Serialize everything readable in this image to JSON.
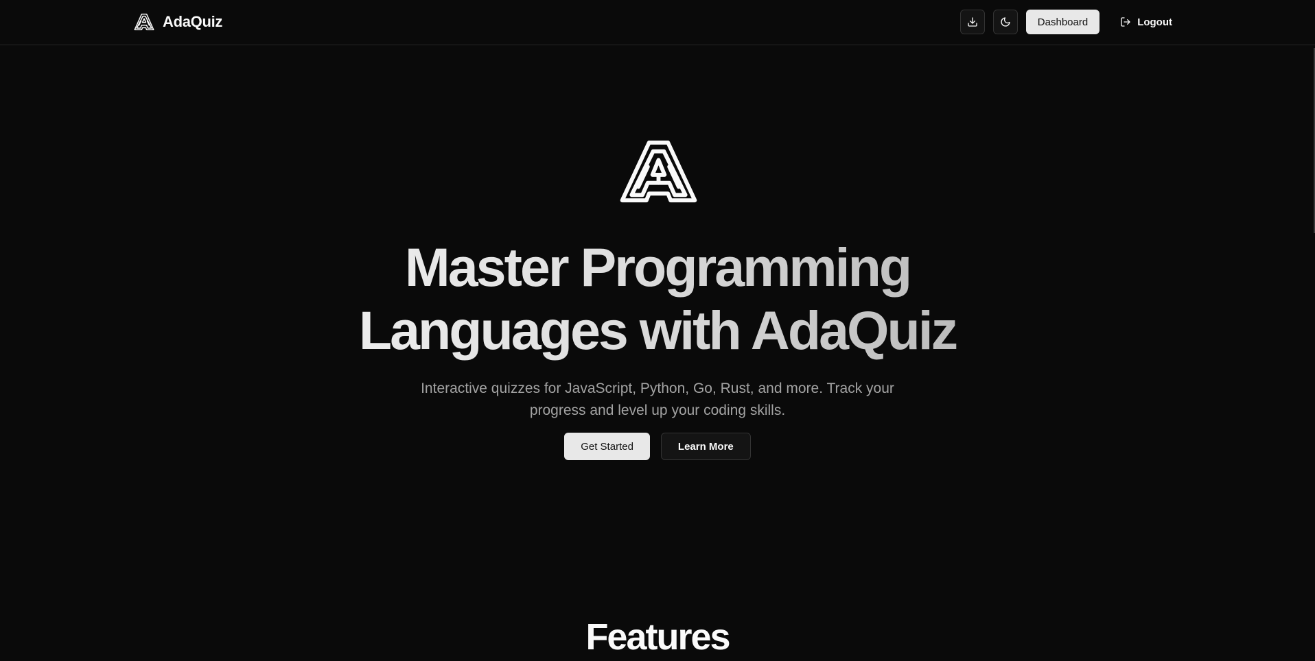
{
  "app": {
    "name": "AdaQuiz",
    "logo_icon": "adaquiz-logo-icon"
  },
  "header": {
    "download_icon": "download-icon",
    "theme_icon": "moon-icon",
    "dashboard_label": "Dashboard",
    "logout_label": "Logout",
    "logout_icon": "logout-icon"
  },
  "hero": {
    "title_line1": "Master Programming",
    "title_line2": "Languages with AdaQuiz",
    "subtitle": "Interactive quizzes for JavaScript, Python, Go, Rust, and more. Track your progress and level up your coding skills.",
    "primary_cta": "Get Started",
    "secondary_cta": "Learn More"
  },
  "features": {
    "heading": "Features"
  },
  "colors": {
    "background": "#0a0a0a",
    "foreground": "#fafafa",
    "muted": "#a3a3a3",
    "primary_button": "#e8e8e8",
    "border": "#262626"
  }
}
